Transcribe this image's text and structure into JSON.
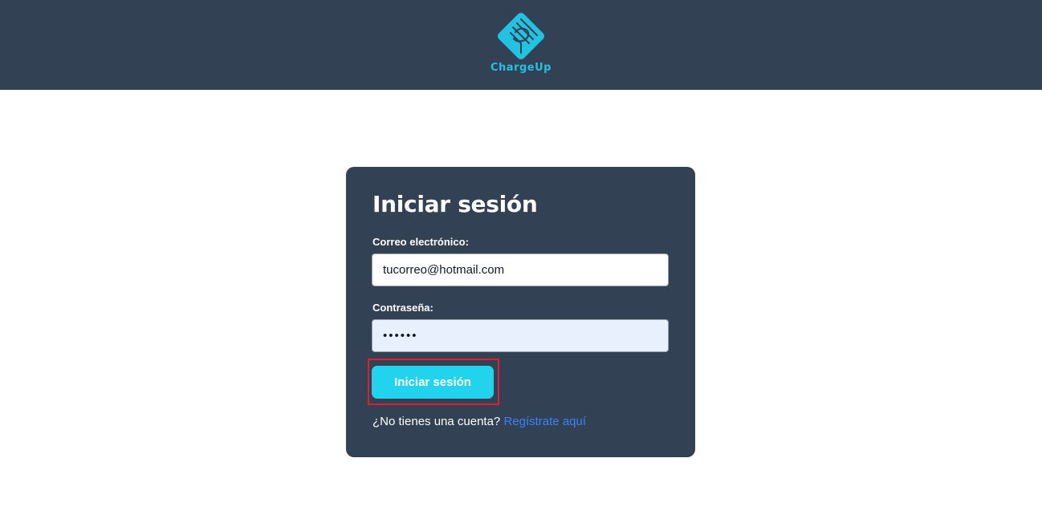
{
  "header": {
    "brand_name": "ChargeUp",
    "brand_color": "#22c3e0",
    "background": "#334155",
    "logo_icon": "chargeup-logo-icon"
  },
  "login": {
    "title": "Iniciar sesión",
    "email_label": "Correo electrónico:",
    "email_value": "tucorreo@hotmail.com",
    "password_label": "Contraseña:",
    "password_value": "••••••",
    "submit_label": "Iniciar sesión",
    "submit_color": "#22d3ee",
    "signup_prompt": "¿No tienes una cuenta?",
    "signup_link": "Regístrate aquí",
    "highlight_color": "#e11d2e"
  }
}
